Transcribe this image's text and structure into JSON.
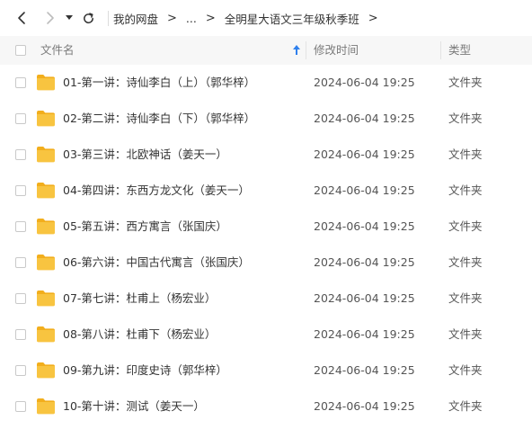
{
  "breadcrumb": {
    "root": "我的网盘",
    "ellipsis": "...",
    "current": "全明星大语文三年级秋季班"
  },
  "columns": {
    "name": "文件名",
    "modified": "修改时间",
    "type": "类型"
  },
  "sort": {
    "column": "name",
    "direction": "ascending"
  },
  "icons": {
    "back": "chevron-left-icon",
    "forward": "chevron-right-icon",
    "history": "caret-down-icon",
    "refresh": "refresh-icon",
    "folder": "folder-icon",
    "sort": "sort-up-arrow-icon"
  },
  "colors": {
    "folder": "#f8c440",
    "folder_tab": "#f2ae1c",
    "sort_arrow": "#2f80ed",
    "header_bg": "#f7f7f7"
  },
  "files": [
    {
      "name": "01-第一讲：诗仙李白（上）（郭华梓）",
      "modified": "2024-06-04 19:25",
      "type": "文件夹"
    },
    {
      "name": "02-第二讲：诗仙李白（下）（郭华梓）",
      "modified": "2024-06-04 19:25",
      "type": "文件夹"
    },
    {
      "name": "03-第三讲：北欧神话（姜天一）",
      "modified": "2024-06-04 19:25",
      "type": "文件夹"
    },
    {
      "name": "04-第四讲：东西方龙文化（姜天一）",
      "modified": "2024-06-04 19:25",
      "type": "文件夹"
    },
    {
      "name": "05-第五讲：西方寓言（张国庆）",
      "modified": "2024-06-04 19:25",
      "type": "文件夹"
    },
    {
      "name": "06-第六讲：中国古代寓言（张国庆）",
      "modified": "2024-06-04 19:25",
      "type": "文件夹"
    },
    {
      "name": "07-第七讲：杜甫上（杨宏业）",
      "modified": "2024-06-04 19:25",
      "type": "文件夹"
    },
    {
      "name": "08-第八讲：杜甫下（杨宏业）",
      "modified": "2024-06-04 19:25",
      "type": "文件夹"
    },
    {
      "name": "09-第九讲：印度史诗（郭华梓）",
      "modified": "2024-06-04 19:25",
      "type": "文件夹"
    },
    {
      "name": "10-第十讲：测试（姜天一）",
      "modified": "2024-06-04 19:25",
      "type": "文件夹"
    }
  ]
}
